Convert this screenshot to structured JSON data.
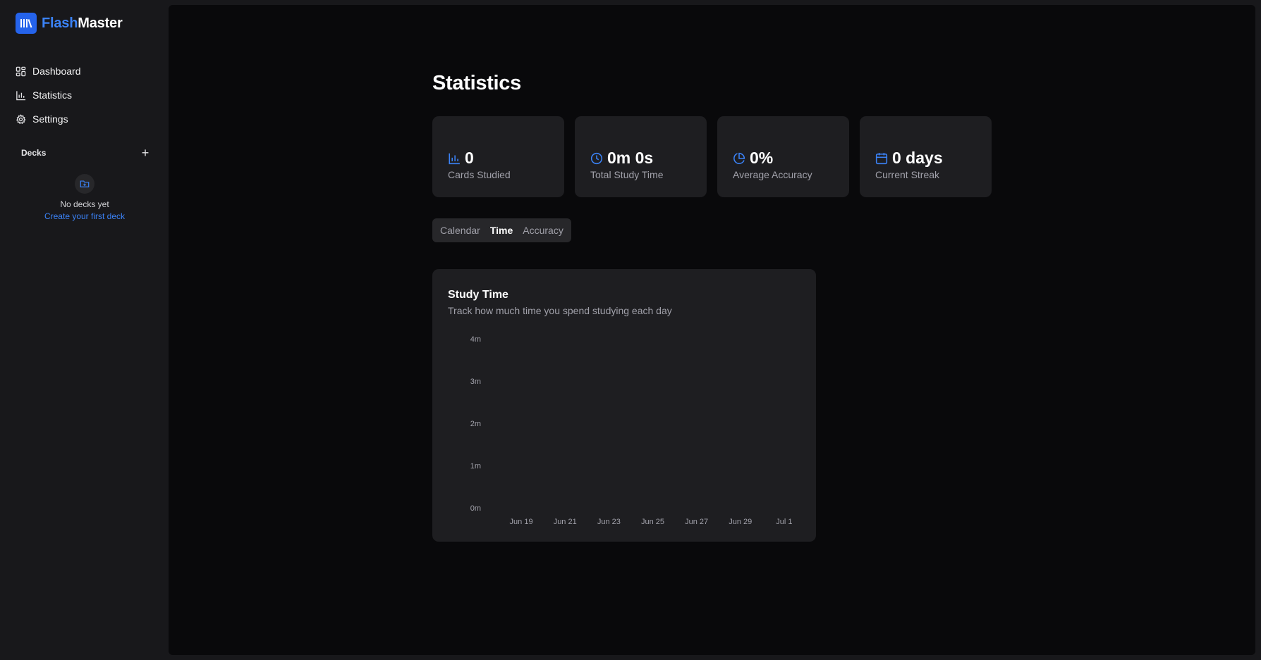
{
  "brand": {
    "part1": "Flash",
    "part2": "Master",
    "accent": "#2563eb"
  },
  "nav": {
    "items": [
      {
        "label": "Dashboard",
        "icon": "grid-icon"
      },
      {
        "label": "Statistics",
        "icon": "bar-chart-icon"
      },
      {
        "label": "Settings",
        "icon": "gear-icon"
      }
    ]
  },
  "decks": {
    "title": "Decks",
    "add_label": "+",
    "empty_text": "No decks yet",
    "empty_link": "Create your first deck"
  },
  "page": {
    "title": "Statistics"
  },
  "stats": [
    {
      "value": "0",
      "label": "Cards Studied",
      "icon": "bar-chart-icon"
    },
    {
      "value": "0m 0s",
      "label": "Total Study Time",
      "icon": "clock-icon"
    },
    {
      "value": "0%",
      "label": "Average Accuracy",
      "icon": "pie-chart-icon"
    },
    {
      "value": "0 days",
      "label": "Current Streak",
      "icon": "calendar-icon"
    }
  ],
  "tabs": [
    {
      "label": "Calendar",
      "active": false
    },
    {
      "label": "Time",
      "active": true
    },
    {
      "label": "Accuracy",
      "active": false
    }
  ],
  "chart_card": {
    "title": "Study Time",
    "subtitle": "Track how much time you spend studying each day"
  },
  "chart_data": {
    "type": "bar",
    "title": "Study Time",
    "xlabel": "",
    "ylabel": "",
    "categories": [
      "Jun 19",
      "Jun 21",
      "Jun 23",
      "Jun 25",
      "Jun 27",
      "Jun 29",
      "Jul 1"
    ],
    "values": [
      0,
      0,
      0,
      0,
      0,
      0,
      0
    ],
    "yticks": [
      "0m",
      "1m",
      "2m",
      "3m",
      "4m"
    ],
    "ylim": [
      0,
      4
    ],
    "grid": false
  }
}
